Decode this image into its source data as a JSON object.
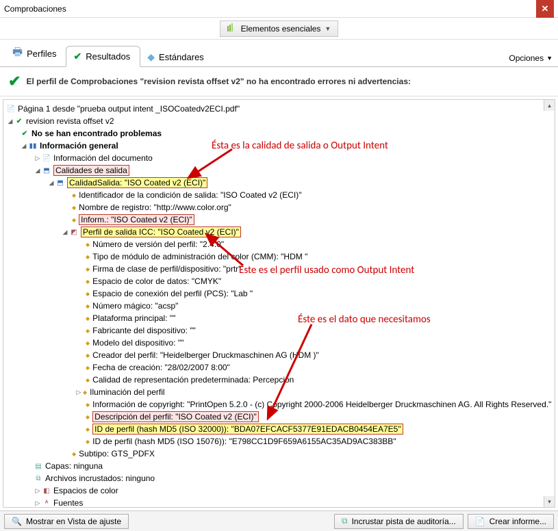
{
  "window": {
    "title": "Comprobaciones"
  },
  "topbar": {
    "essence": "Elementos esenciales"
  },
  "tabs": {
    "profiles": "Perfiles",
    "results": "Resultados",
    "standards": "Estándares",
    "options": "Opciones"
  },
  "status": {
    "text": "El perfil de Comprobaciones \"revision revista offset v2\" no ha encontrado errores ni advertencias:"
  },
  "tree": {
    "page_line": "Página 1 desde \"prueba output intent _ISOCoatedv2ECI.pdf\"",
    "profile_name": "revision revista offset v2",
    "no_problems": "No se han encontrado problemas",
    "info_general": "Información general",
    "info_doc": "Información del documento",
    "calidades_salida": "Calidades de salida",
    "calidad_salida": "CalidadSalida: \"ISO Coated v2 (ECI)\"",
    "ident_cond": "Identificador de la condición de salida: \"ISO Coated v2 (ECI)\"",
    "nombre_reg": "Nombre de registro: \"http://www.color.org\"",
    "inform": "Inform.: \"ISO Coated v2 (ECI)\"",
    "perfil_icc": "Perfil de salida ICC: \"ISO Coated v2 (ECI)\"",
    "num_version": "Número de versión del perfil: \"2.4.0\"",
    "tipo_modulo": "Tipo de módulo de administración del color (CMM): \"HDM \"",
    "firma_clase": "Firma de clase de perfil/dispositivo: \"prtr\"",
    "esp_color_datos": "Espacio de color de datos: \"CMYK\"",
    "esp_conexion": "Espacio de conexión del perfil (PCS): \"Lab \"",
    "num_magico": "Número mágico: \"acsp\"",
    "plataforma": "Plataforma principal: \"\"",
    "fabricante": "Fabricante del dispositivo: \"\"",
    "modelo": "Modelo del dispositivo: \"\"",
    "creador": "Creador del perfil: \"Heidelberger Druckmaschinen AG (HDM )\"",
    "fecha": "Fecha de creación: \"28/02/2007 8:00\"",
    "calidad_rep": "Calidad de representación predeterminada: Percepción",
    "iluminacion": "Iluminación del perfil",
    "copyright": "Información de copyright: \"PrintOpen 5.2.0 - (c) Copyright 2000-2006 Heidelberger Druckmaschinen AG. All Rights Reserved.\"",
    "descripcion": "Descripción del perfil: \"ISO Coated v2 (ECI)\"",
    "id_32000": "ID de perfil (hash MD5 (ISO 32000)): \"BDA07EFCACF5377E91EDACB0454EA7E5\"",
    "id_15076": "ID de perfil (hash MD5 (ISO 15076)): \"E798CC1D9F659A6155AC35AD9AC383BB\"",
    "subtipo": "Subtipo: GTS_PDFX",
    "capas": "Capas: ninguna",
    "archivos_inc": "Archivos incrustados: ninguno",
    "espacios_color": "Espacios de color",
    "fuentes": "Fuentes"
  },
  "annotations": {
    "a1": "Ésta es la calidad de salida o Output Intent",
    "a2": "Éste es el perfil usado como Output Intent",
    "a3": "Éste es el dato que necesitamos"
  },
  "footer": {
    "mostrar": "Mostrar en Vista de ajuste",
    "incrustar": "Incrustar pista de auditoría...",
    "crear": "Crear informe..."
  }
}
